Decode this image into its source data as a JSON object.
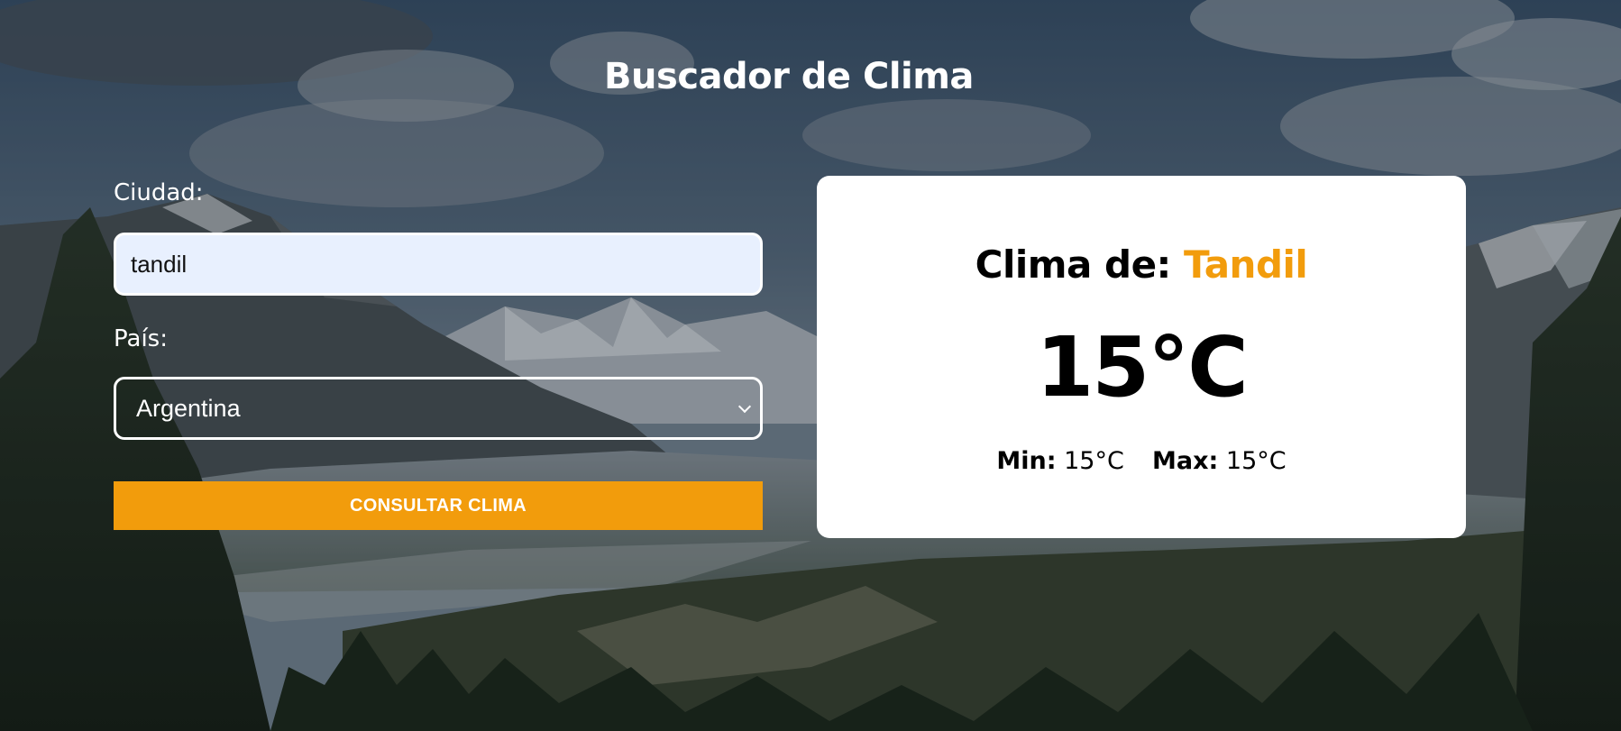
{
  "page": {
    "title": "Buscador de Clima"
  },
  "form": {
    "city_label": "Ciudad:",
    "city_value": "tandil",
    "country_label": "País:",
    "country_selected": "Argentina",
    "submit_label": "Consultar Clima"
  },
  "result": {
    "heading_prefix": "Clima de:",
    "city": "Tandil",
    "temperature": "15°C",
    "min_label": "Min:",
    "min_value": "15°C",
    "max_label": "Max:",
    "max_value": "15°C"
  },
  "colors": {
    "accent": "#f29c0c",
    "input_background": "#e8f0fe",
    "card_background": "#ffffff"
  },
  "icons": {
    "select_chevron": "chevron-down-icon"
  }
}
